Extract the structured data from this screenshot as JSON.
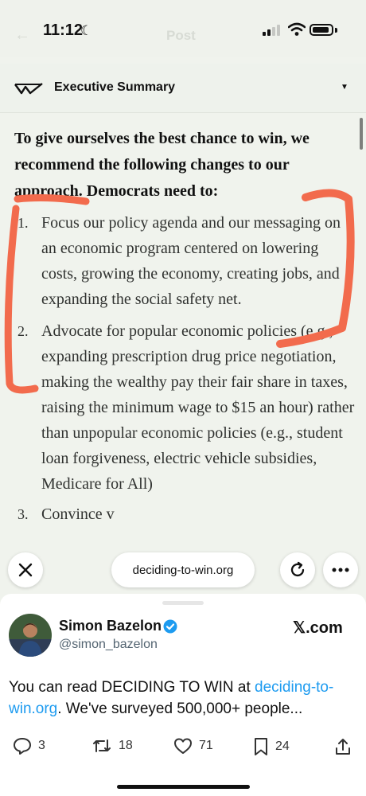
{
  "status_bar": {
    "time": "11:12",
    "faded_title": "Post"
  },
  "doc": {
    "title": "Executive Summary",
    "lead": "To give ourselves the best chance to win, we recommend the following changes to our approach. Democrats need to:",
    "items": [
      {
        "num": "1.",
        "text": "Focus our policy agenda and our messaging on an economic program centered on lowering costs, growing the economy, creating jobs, and expanding the social safety net."
      },
      {
        "num": "2.",
        "text": "Advocate for popular economic policies (e.g., expanding prescription drug price negotiation, making the wealthy pay their fair share in taxes, raising the minimum wage to $15 an hour) rather than unpopular economic policies (e.g., student loan forgiveness, electric vehicle subsidies, Medicare for All)"
      },
      {
        "num": "3.",
        "text": "Convince v"
      }
    ],
    "annotation_color": "#f26b4d"
  },
  "browser_bar": {
    "url": "deciding-to-win.org"
  },
  "tweet": {
    "author_name": "Simon Bazelon",
    "handle": "@simon_bazelon",
    "source": "𝕏.com",
    "text_before_link": "You can read DECIDING TO WIN at ",
    "link": "deciding-to-win.org",
    "text_after_link": ". We've surveyed 500,000+ people...",
    "replies": "3",
    "reposts": "18",
    "likes": "71",
    "bookmarks": "24",
    "accent": "#1d9bf0"
  }
}
